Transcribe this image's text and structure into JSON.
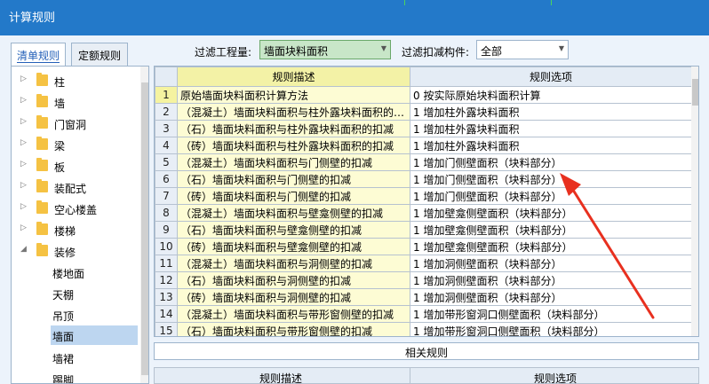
{
  "window": {
    "title": "计算规则"
  },
  "tabs": [
    {
      "label": "清单规则",
      "active": true
    },
    {
      "label": "定额规则",
      "active": false
    }
  ],
  "filters": {
    "project_label": "过滤工程量:",
    "project_value": "墙面块料面积",
    "component_label": "过滤扣减构件:",
    "component_value": "全部"
  },
  "tree": {
    "items": [
      {
        "label": "柱",
        "expanded": false
      },
      {
        "label": "墙",
        "expanded": false
      },
      {
        "label": "门窗洞",
        "expanded": false
      },
      {
        "label": "梁",
        "expanded": false
      },
      {
        "label": "板",
        "expanded": false
      },
      {
        "label": "装配式",
        "expanded": false
      },
      {
        "label": "空心楼盖",
        "expanded": false
      },
      {
        "label": "楼梯",
        "expanded": false
      },
      {
        "label": "装修",
        "expanded": true
      }
    ],
    "children": [
      {
        "label": "楼地面",
        "selected": false
      },
      {
        "label": "天棚",
        "selected": false
      },
      {
        "label": "吊顶",
        "selected": false
      },
      {
        "label": "墙面",
        "selected": true
      },
      {
        "label": "墙裙",
        "selected": false
      },
      {
        "label": "踢脚",
        "selected": false
      }
    ]
  },
  "grid": {
    "headers": {
      "desc": "规则描述",
      "option": "规则选项"
    },
    "rows": [
      {
        "num": "1",
        "desc": "原始墙面块料面积计算方法",
        "option": "0  按实际原始块料面积计算"
      },
      {
        "num": "2",
        "desc": "（混凝土）墙面块料面积与柱外露块料面积的…",
        "option": "1  增加柱外露块料面积"
      },
      {
        "num": "3",
        "desc": "（石）墙面块料面积与柱外露块料面积的扣减",
        "option": "1  增加柱外露块料面积"
      },
      {
        "num": "4",
        "desc": "（砖）墙面块料面积与柱外露块料面积的扣减",
        "option": "1  增加柱外露块料面积"
      },
      {
        "num": "5",
        "desc": "（混凝土）墙面块料面积与门侧壁的扣减",
        "option": "1  增加门侧壁面积（块料部分）"
      },
      {
        "num": "6",
        "desc": "（石）墙面块料面积与门侧壁的扣减",
        "option": "1  增加门侧壁面积（块料部分）"
      },
      {
        "num": "7",
        "desc": "（砖）墙面块料面积与门侧壁的扣减",
        "option": "1  增加门侧壁面积（块料部分）"
      },
      {
        "num": "8",
        "desc": "（混凝土）墙面块料面积与壁龛侧壁的扣减",
        "option": "1  增加壁龛侧壁面积（块料部分）"
      },
      {
        "num": "9",
        "desc": "（石）墙面块料面积与壁龛侧壁的扣减",
        "option": "1  增加壁龛侧壁面积（块料部分）"
      },
      {
        "num": "10",
        "desc": "（砖）墙面块料面积与壁龛侧壁的扣减",
        "option": "1  增加壁龛侧壁面积（块料部分）"
      },
      {
        "num": "11",
        "desc": "（混凝土）墙面块料面积与洞侧壁的扣减",
        "option": "1  增加洞侧壁面积（块料部分）"
      },
      {
        "num": "12",
        "desc": "（石）墙面块料面积与洞侧壁的扣减",
        "option": "1  增加洞侧壁面积（块料部分）"
      },
      {
        "num": "13",
        "desc": "（砖）墙面块料面积与洞侧壁的扣减",
        "option": "1  增加洞侧壁面积（块料部分）"
      },
      {
        "num": "14",
        "desc": "（混凝土）墙面块料面积与带形窗侧壁的扣减",
        "option": "1  增加带形窗洞口侧壁面积（块料部分）"
      },
      {
        "num": "15",
        "desc": "（石）墙面块料面积与带形窗侧壁的扣减",
        "option": "1  增加带形窗洞口侧壁面积（块料部分）"
      }
    ]
  },
  "related": {
    "label": "相关规则"
  },
  "bottom_grid": {
    "desc": "规则描述",
    "option": "规则选项"
  },
  "colors": {
    "titlebar": "#2379c9",
    "desc_cell": "#fdfcd4",
    "selected_tree": "#bdd6f0",
    "annotation_arrow": "#e8301f"
  }
}
